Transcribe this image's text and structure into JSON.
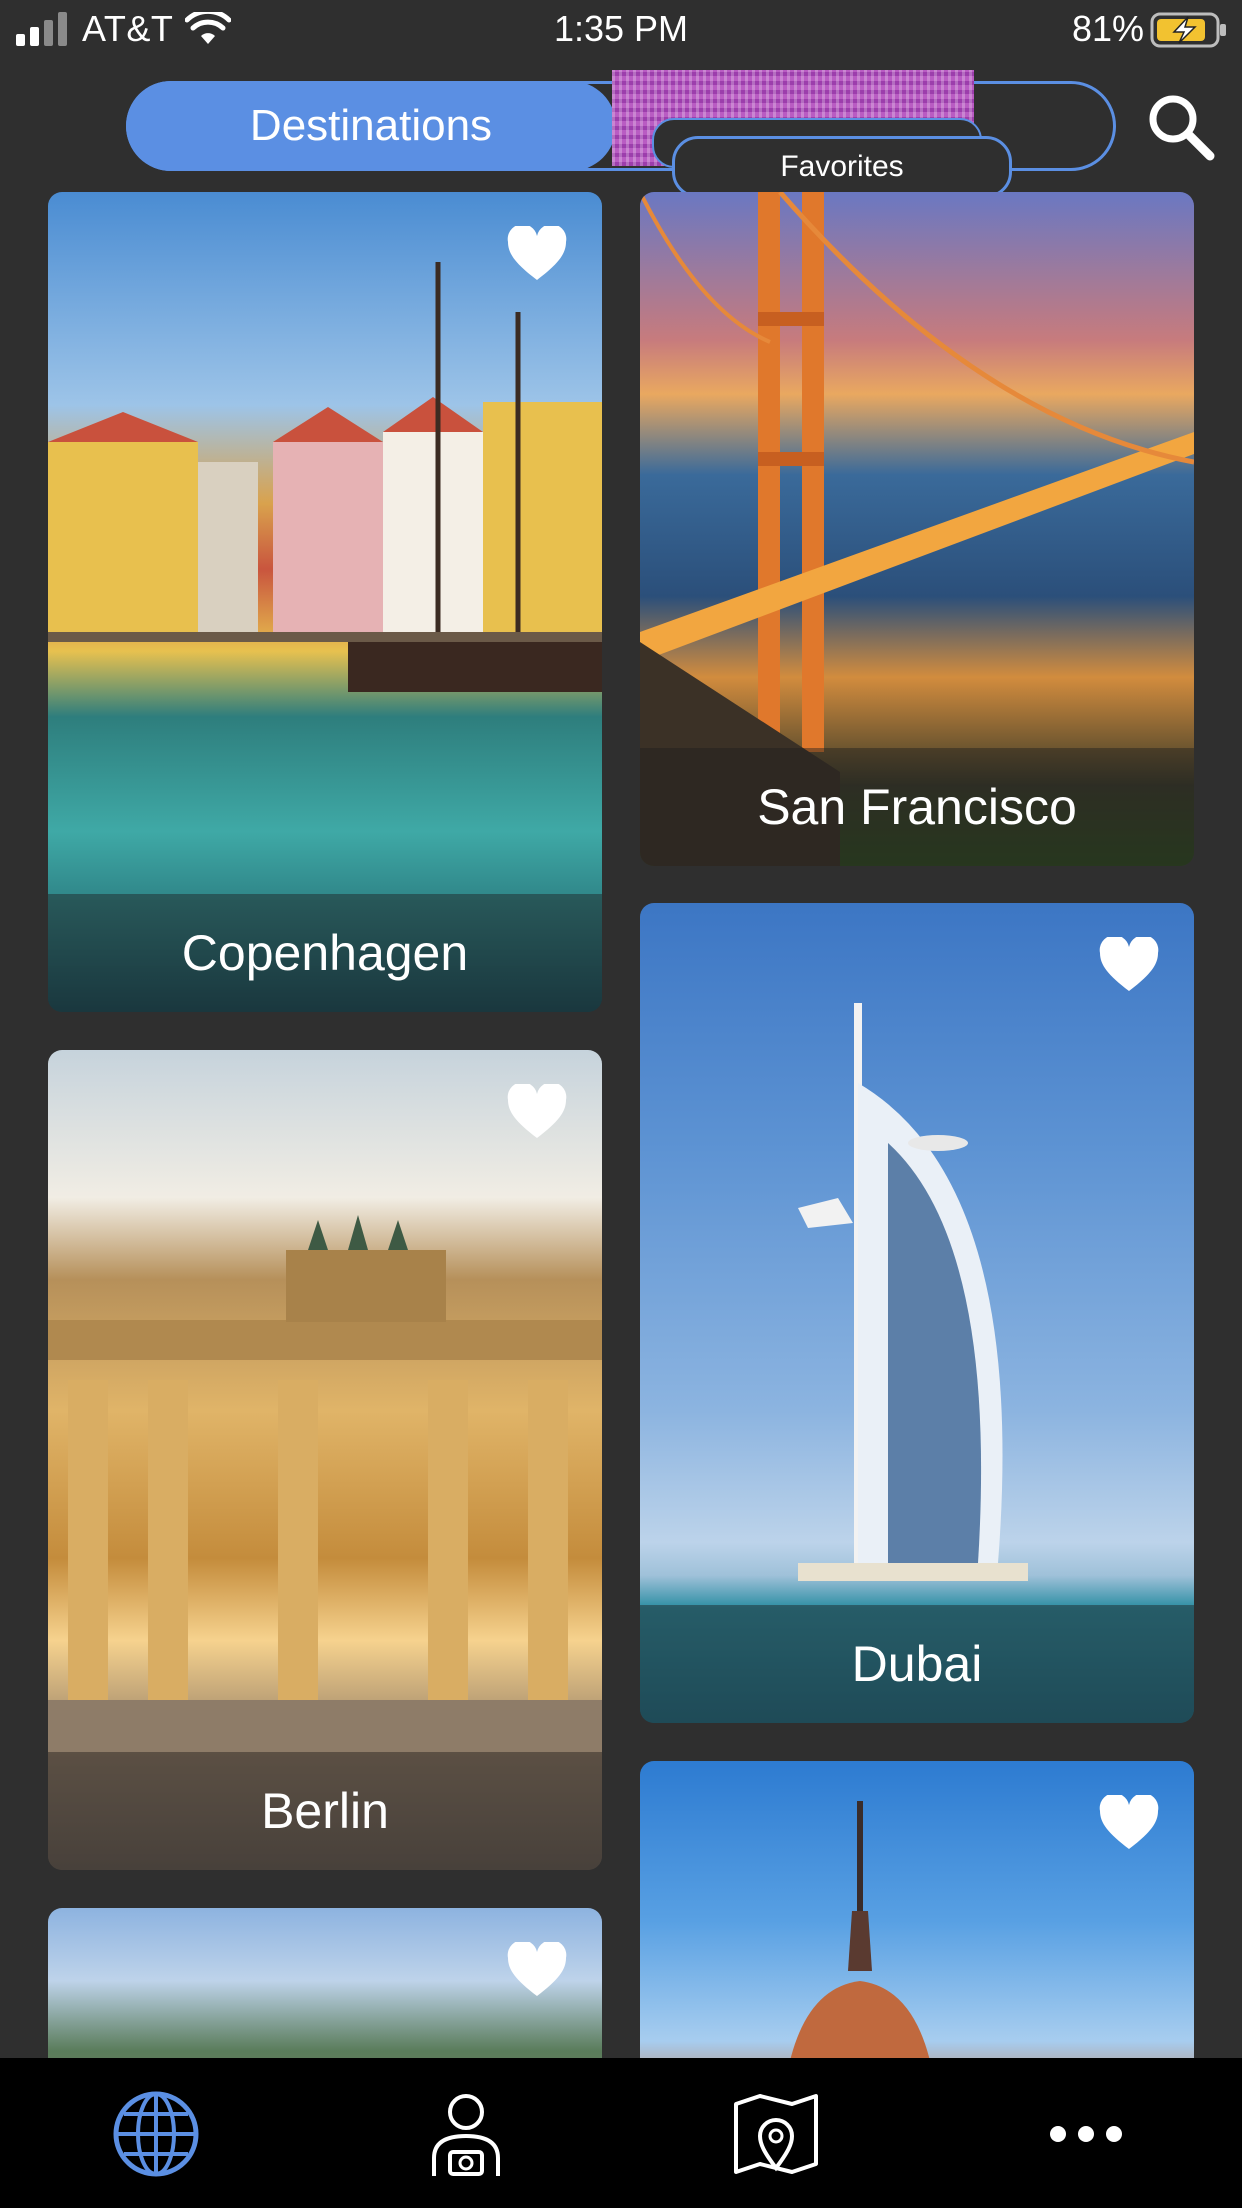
{
  "status_bar": {
    "carrier": "AT&T",
    "time": "1:35 PM",
    "battery_percent": "81%"
  },
  "header": {
    "tabs": [
      {
        "label": "Destinations",
        "active": true
      },
      {
        "label": "Favorites",
        "active": false
      }
    ]
  },
  "destinations": [
    {
      "name": "Copenhagen",
      "favorite": true
    },
    {
      "name": "San Francisco",
      "favorite": false
    },
    {
      "name": "Berlin",
      "favorite": true
    },
    {
      "name": "Dubai",
      "favorite": true
    },
    {
      "name": "",
      "favorite": true
    },
    {
      "name": "",
      "favorite": true
    }
  ],
  "tab_bar": {
    "items": [
      "globe-icon",
      "traveler-camera-icon",
      "map-pin-icon",
      "more-icon"
    ],
    "active_index": 0,
    "accent_color": "#5b8fe3"
  },
  "colors": {
    "accent": "#5b8fe3",
    "background": "#2f2f2f",
    "tab_bar": "#000000"
  }
}
